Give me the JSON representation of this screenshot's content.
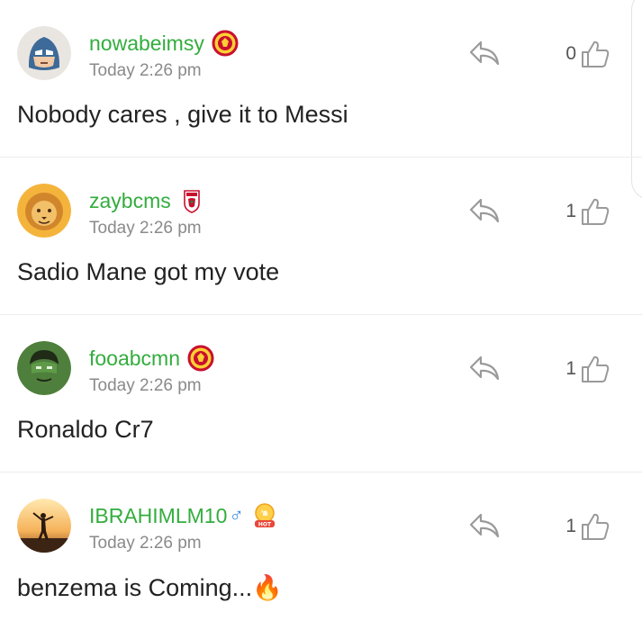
{
  "comments": [
    {
      "username": "nowabeimsy",
      "badge": "man-utd-crest-icon",
      "time": "Today 2:26 pm",
      "likes": "0",
      "text": "Nobody cares , give it to Messi",
      "avatar": "captain-mask-avatar"
    },
    {
      "username": "zaybcms",
      "badge": "liverpool-crest-icon",
      "time": "Today 2:26 pm",
      "likes": "1",
      "text": "Sadio Mane got my vote",
      "avatar": "lion-avatar"
    },
    {
      "username": "fooabcmn",
      "badge": "man-utd-crest-icon",
      "time": "Today 2:26 pm",
      "likes": "1",
      "text": "Ronaldo Cr7",
      "avatar": "hulk-avatar"
    },
    {
      "username": "IBRAHIMLM10",
      "gender": "♂",
      "badge": "hot-medal-icon",
      "time": "Today 2:26 pm",
      "likes": "1",
      "text": "benzema is Coming...",
      "emoji": "🔥",
      "avatar": "sunset-silhouette-avatar"
    }
  ],
  "colors": {
    "username": "#33ad3e",
    "timestamp": "#8a8a8a",
    "icon": "#9a9a9a",
    "male": "#3a8fe0"
  }
}
